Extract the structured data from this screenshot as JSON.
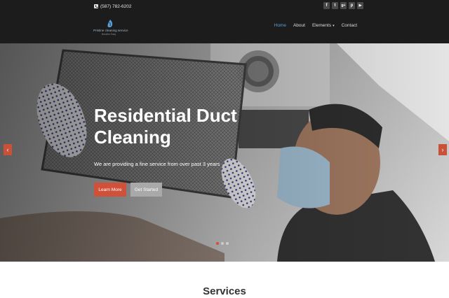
{
  "topbar": {
    "phone": "(587) 782-6202",
    "phone_icon": "phone-icon",
    "socials": [
      {
        "name": "facebook-icon",
        "glyph": "f"
      },
      {
        "name": "twitter-icon",
        "glyph": "t"
      },
      {
        "name": "google-plus-icon",
        "glyph": "g+"
      },
      {
        "name": "pinterest-icon",
        "glyph": "p"
      },
      {
        "name": "youtube-icon",
        "glyph": "▶"
      }
    ]
  },
  "header": {
    "logo_name": "Pristine cleaning service",
    "logo_tagline": "Breathe Easy",
    "nav": [
      {
        "label": "Home",
        "active": true
      },
      {
        "label": "About",
        "active": false
      },
      {
        "label": "Elements",
        "active": false,
        "dropdown": true
      },
      {
        "label": "Contact",
        "active": false
      }
    ]
  },
  "hero": {
    "title": "Residential Duct Cleaning",
    "subtitle": "We are providing a fine service from over past 3 years",
    "learn_more": "Learn More",
    "get_started": "Get Started",
    "prev_glyph": "‹",
    "next_glyph": "›",
    "slide_count": 3,
    "active_slide": 0
  },
  "services": {
    "title": "Services"
  },
  "colors": {
    "topbar_bg": "#1c1c1c",
    "accent": "#d0513a",
    "nav_active": "#5aa0d8",
    "secondary_button": "#a9a9a9"
  }
}
